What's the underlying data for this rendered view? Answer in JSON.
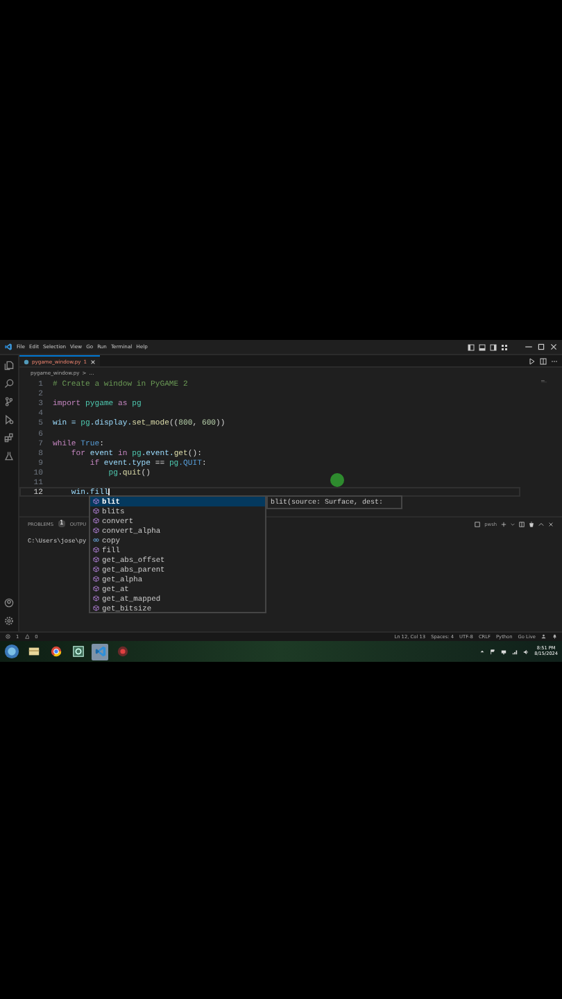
{
  "menu": [
    "File",
    "Edit",
    "Selection",
    "View",
    "Go",
    "Run",
    "Terminal",
    "Help"
  ],
  "tabs": [
    {
      "label": "pygame_window.py",
      "badge": "1",
      "selected": true
    }
  ],
  "breadcrumb": [
    "pygame_window.py",
    ">",
    "..."
  ],
  "code_lines": [
    {
      "number": "1",
      "current": false,
      "tokens": [
        {
          "text": "# Create a window in PyGAME 2",
          "kind": "comment"
        }
      ]
    },
    {
      "number": "2",
      "current": false
    },
    {
      "number": "3",
      "current": false,
      "tokens": [
        {
          "text": "import",
          "kind": "keyword"
        },
        {
          "text": " pygame",
          "kind": "module"
        },
        {
          "text": " as",
          "kind": "keyword"
        },
        {
          "text": " pg",
          "kind": "module"
        }
      ]
    },
    {
      "number": "4",
      "current": false
    },
    {
      "number": "5",
      "current": false,
      "tokens": [
        {
          "text": "win = ",
          "kind": "variable"
        },
        {
          "text": "pg",
          "kind": "module"
        },
        {
          "text": ".display.",
          "kind": "variable"
        },
        {
          "text": "set_mode",
          "kind": "function"
        },
        {
          "text": "((",
          "kind": "plain"
        },
        {
          "text": "800",
          "kind": "number"
        },
        {
          "text": ", ",
          "kind": "plain"
        },
        {
          "text": "600",
          "kind": "number"
        },
        {
          "text": "))",
          "kind": "plain"
        }
      ]
    },
    {
      "number": "6",
      "current": false
    },
    {
      "number": "7",
      "current": false,
      "tokens": [
        {
          "text": "while",
          "kind": "keyword"
        },
        {
          "text": " True",
          "kind": "constant"
        },
        {
          "text": ":",
          "kind": "plain"
        }
      ]
    },
    {
      "number": "8",
      "current": false,
      "tokens": [
        {
          "text": "    for",
          "kind": "keyword"
        },
        {
          "text": " event",
          "kind": "variable"
        },
        {
          "text": " in",
          "kind": "keyword"
        },
        {
          "text": " pg",
          "kind": "module"
        },
        {
          "text": ".event.",
          "kind": "variable"
        },
        {
          "text": "get",
          "kind": "function"
        },
        {
          "text": "():",
          "kind": "plain"
        }
      ]
    },
    {
      "number": "9",
      "current": false,
      "tokens": [
        {
          "text": "        if",
          "kind": "keyword"
        },
        {
          "text": " event.type",
          "kind": "variable"
        },
        {
          "text": " == ",
          "kind": "plain"
        },
        {
          "text": "pg",
          "kind": "module"
        },
        {
          "text": ".QUIT",
          "kind": "constant"
        },
        {
          "text": ":",
          "kind": "plain"
        }
      ]
    },
    {
      "number": "10",
      "current": false,
      "tokens": [
        {
          "text": "            pg",
          "kind": "module"
        },
        {
          "text": ".",
          "kind": "plain"
        },
        {
          "text": "quit",
          "kind": "function"
        },
        {
          "text": "()",
          "kind": "plain"
        }
      ]
    },
    {
      "number": "11",
      "current": false
    },
    {
      "number": "12",
      "current": true,
      "tokens": [
        {
          "text": "    win.fill",
          "kind": "variable"
        }
      ]
    }
  ],
  "suggestions": [
    {
      "label": "blit",
      "kind": "method",
      "selected": true
    },
    {
      "label": "blits",
      "kind": "method",
      "selected": false
    },
    {
      "label": "convert",
      "kind": "method",
      "selected": false
    },
    {
      "label": "convert_alpha",
      "kind": "method",
      "selected": false
    },
    {
      "label": "copy",
      "kind": "field",
      "selected": false
    },
    {
      "label": "fill",
      "kind": "method",
      "selected": false
    },
    {
      "label": "get_abs_offset",
      "kind": "method",
      "selected": false
    },
    {
      "label": "get_abs_parent",
      "kind": "method",
      "selected": false
    },
    {
      "label": "get_alpha",
      "kind": "method",
      "selected": false
    },
    {
      "label": "get_at",
      "kind": "method",
      "selected": false
    },
    {
      "label": "get_at_mapped",
      "kind": "method",
      "selected": false
    },
    {
      "label": "get_bitsize",
      "kind": "method",
      "selected": false
    }
  ],
  "signature_hint": "blit(source: Surface, dest: ",
  "panel": {
    "tabs": [
      {
        "label": "PROBLEMS",
        "badge": "1"
      },
      {
        "label": "OUTPU"
      }
    ],
    "shell": "pwsh",
    "terminal_line": "C:\\Users\\jose\\py"
  },
  "status_bar": {
    "errors": "1",
    "warnings": "0",
    "items": [
      "Ln 12, Col 13",
      "Spaces: 4",
      "UTF-8",
      "CRLF",
      "Python",
      "Go Live"
    ]
  },
  "taskbar": {
    "apps": [
      {
        "kind": "folder",
        "selected": false
      },
      {
        "kind": "browser",
        "selected": false
      },
      {
        "kind": "app",
        "selected": false
      },
      {
        "kind": "editor",
        "selected": true
      },
      {
        "kind": "recorder",
        "selected": false
      }
    ],
    "time": "8:51 PM",
    "date": "8/15/2024"
  }
}
